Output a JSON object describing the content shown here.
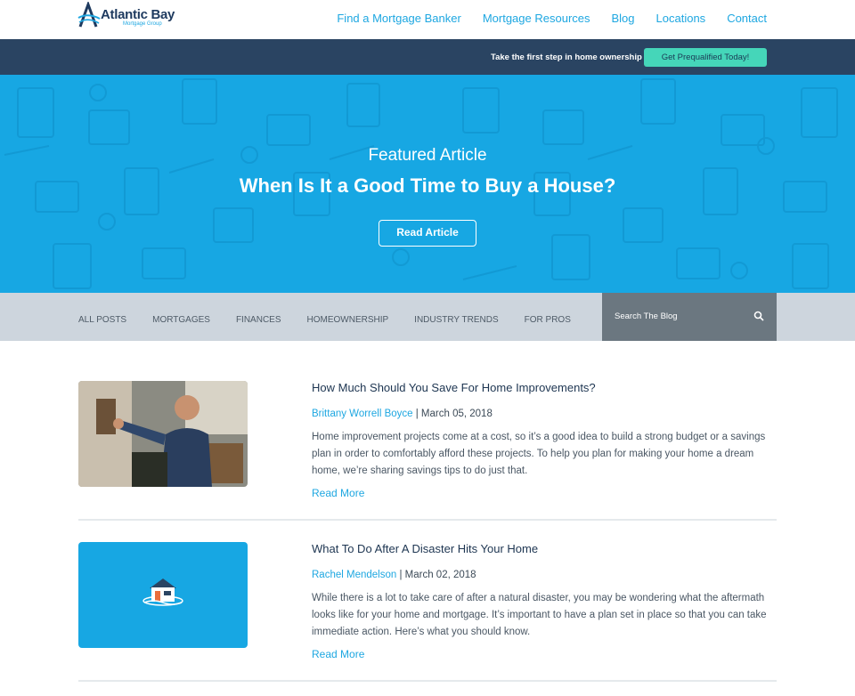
{
  "brand": {
    "name": "Atlantic Bay",
    "tagline": "Mortgage Group",
    "colors": {
      "navy": "#2a4462",
      "blue": "#17a7e3",
      "link": "#1ea7e1",
      "teal": "#45d6b9",
      "grey": "#cdd5dd"
    }
  },
  "nav": {
    "items": [
      "Find a Mortgage Banker",
      "Mortgage Resources",
      "Blog",
      "Locations",
      "Contact"
    ]
  },
  "promo": {
    "text": "Take the first step in home ownership",
    "button": "Get Prequalified Today!"
  },
  "hero": {
    "kicker": "Featured Article",
    "title": "When Is It a Good Time to Buy a House?",
    "button": "Read Article"
  },
  "categories": [
    "ALL POSTS",
    "MORTGAGES",
    "FINANCES",
    "HOMEOWNERSHIP",
    "INDUSTRY TRENDS",
    "FOR PROS"
  ],
  "search": {
    "placeholder": "Search The Blog",
    "icon": "search-icon"
  },
  "posts": [
    {
      "title": "How Much Should You Save For Home Improvements?",
      "author": "Brittany Worrell Boyce",
      "date": "| March 05, 2018",
      "excerpt": "Home improvement projects come at a cost, so it’s a good idea to build a strong budget or a savings plan in order to comfortably afford these projects. To help you plan for making your home a dream home, we’re sharing savings tips to do just that.",
      "read_more": "Read More"
    },
    {
      "title": "What To Do After A Disaster Hits Your Home",
      "author": "Rachel Mendelson",
      "date": "| March 02, 2018",
      "excerpt": "While there is a lot to take care of after a natural disaster, you may be wondering what the aftermath looks like for your home and mortgage. It’s important to have a plan set in place so that you can take immediate action. Here’s what you should know.",
      "read_more": "Read More"
    }
  ]
}
